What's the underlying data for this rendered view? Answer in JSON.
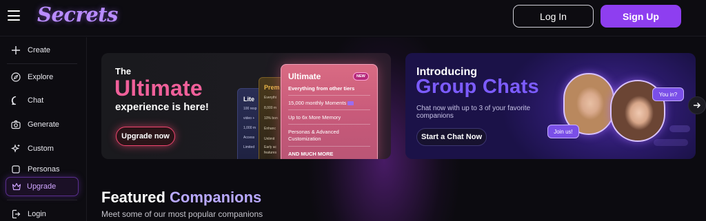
{
  "header": {
    "logo": "Secrets",
    "login_label": "Log In",
    "signup_label": "Sign Up"
  },
  "sidebar": {
    "items": [
      {
        "label": "Create",
        "icon": "plus-icon"
      },
      {
        "label": "Explore",
        "icon": "compass-icon"
      },
      {
        "label": "Chat",
        "icon": "chat-bubble-icon"
      },
      {
        "label": "Generate",
        "icon": "camera-icon"
      },
      {
        "label": "Custom",
        "icon": "sparkle-icon"
      },
      {
        "label": "Personas",
        "icon": "persona-icon"
      },
      {
        "label": "Upgrade",
        "icon": "crown-icon"
      },
      {
        "label": "Login",
        "icon": "login-icon"
      }
    ]
  },
  "banner_ultimate": {
    "pre": "The",
    "headline": "Ultimate",
    "sub": "experience is here!",
    "cta": "Upgrade now",
    "tier_lite": {
      "title": "Lite",
      "lines": [
        "100 resp",
        "video +",
        "1,000 m",
        "Access",
        "Limited"
      ]
    },
    "tier_premium": {
      "title": "Prem",
      "lines": [
        "Everythi",
        "8,000 m",
        "10% bon",
        "Enhanc",
        "Unlimit",
        "Early ac",
        "features"
      ]
    },
    "tier_ultimate": {
      "title": "Ultimate",
      "badge": "NEW",
      "lines": [
        "Everything from other tiers",
        "15,000 monthly Moments",
        "Up to 6x More Memory",
        "Personas & Advanced Customization",
        "AND MUCH MORE"
      ]
    }
  },
  "banner_group": {
    "intro": "Introducing",
    "headline": "Group Chats",
    "sub": "Chat now with up to 3 of your favorite companions",
    "cta": "Start a Chat Now",
    "bubble_you": "You in?",
    "bubble_join": "Join us!"
  },
  "featured": {
    "title_a": "Featured",
    "title_b": "Companions",
    "subtitle": "Meet some of our most popular companions"
  },
  "colors": {
    "accent_purple": "#8e3ef0",
    "ultimate_pink": "#f0609a",
    "group_violet": "#7c5cff"
  }
}
